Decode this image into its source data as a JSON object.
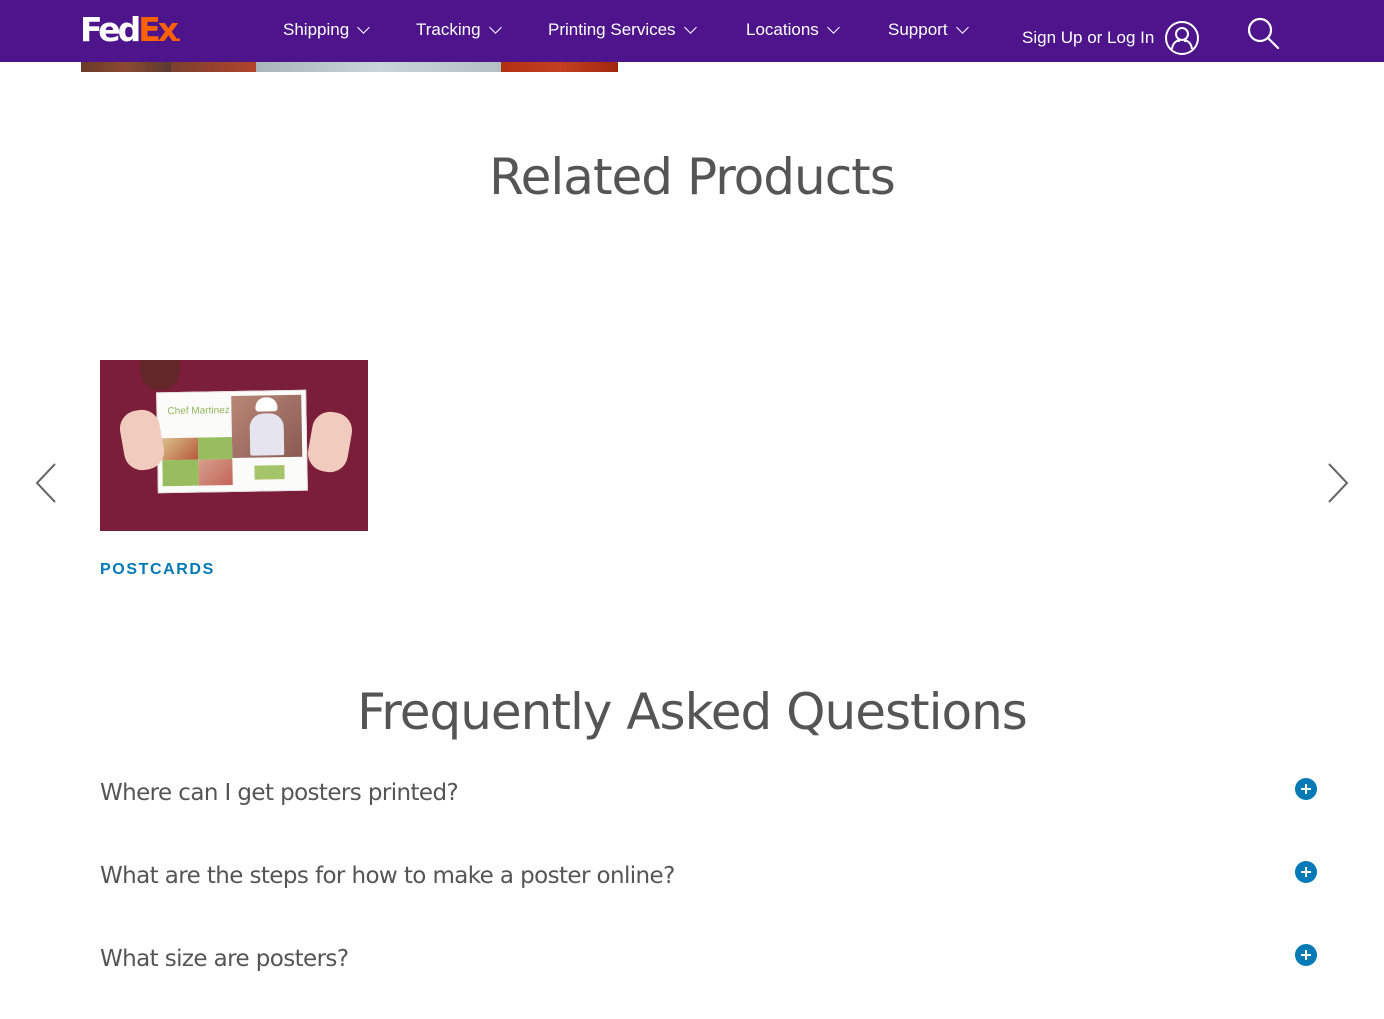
{
  "header": {
    "logo": {
      "part1": "Fed",
      "part2": "Ex",
      "dot": "."
    },
    "nav_items": [
      {
        "label": "Shipping",
        "icon": "chevron-down-icon"
      },
      {
        "label": "Tracking",
        "icon": "chevron-down-icon"
      },
      {
        "label": "Printing Services",
        "icon": "chevron-down-icon"
      },
      {
        "label": "Locations",
        "icon": "chevron-down-icon"
      },
      {
        "label": "Support",
        "icon": "chevron-down-icon"
      }
    ],
    "signin_label": "Sign Up or Log In",
    "signin_icon": "user-icon",
    "search_icon": "search-icon",
    "colors": {
      "brand_purple": "#4d148c",
      "brand_orange": "#ff6200"
    }
  },
  "related_products": {
    "title": "Related Products",
    "prev_icon": "chevron-left-icon",
    "next_icon": "chevron-right-icon",
    "items": [
      {
        "label": "POSTCARDS",
        "image_text": "Chef Martinez"
      }
    ],
    "label_color": "#007ab7"
  },
  "faq": {
    "title": "Frequently Asked Questions",
    "expand_icon": "plus-circle-icon",
    "items": [
      {
        "question": "Where can I get posters printed?"
      },
      {
        "question": "What are the steps for how to make a poster online?"
      },
      {
        "question": "What size are posters?"
      }
    ],
    "accent_color": "#007ab7"
  }
}
